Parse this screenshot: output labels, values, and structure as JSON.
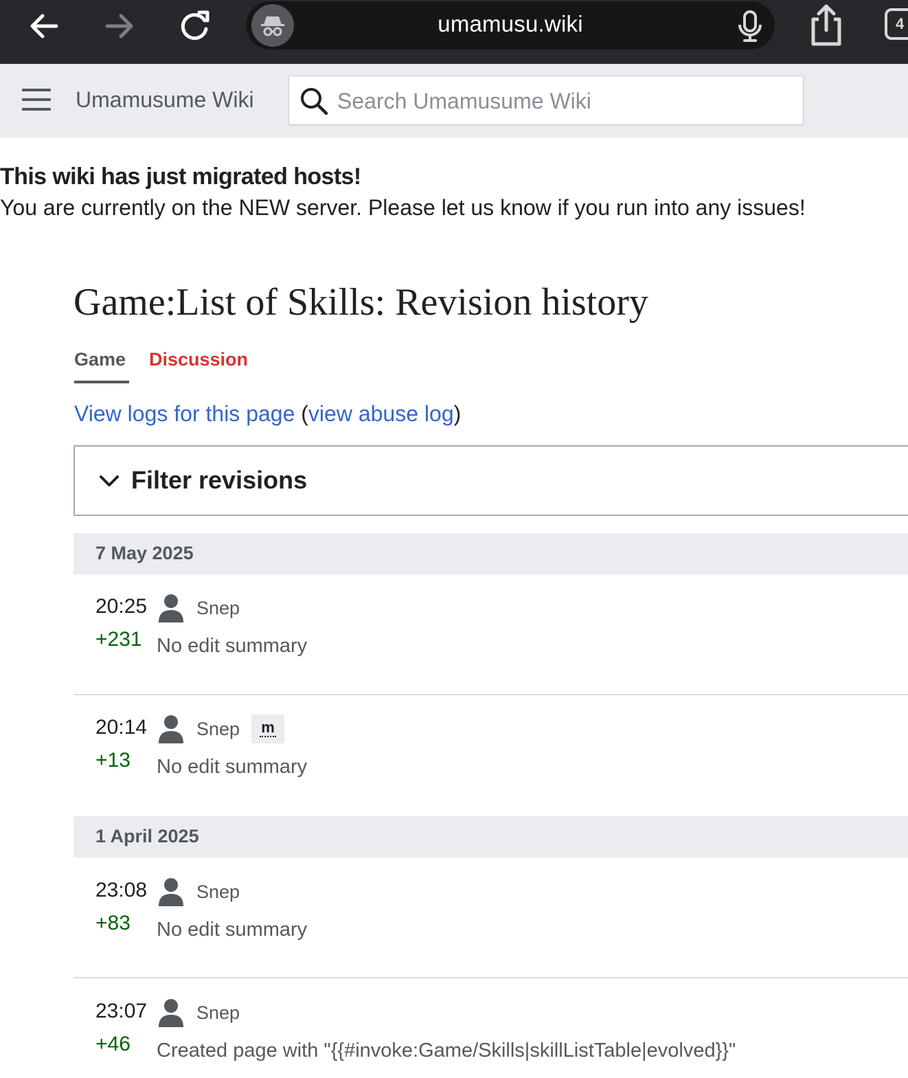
{
  "browser": {
    "url": "umamusu.wiki",
    "tab_count": "4"
  },
  "header": {
    "site_name": "Umamusume Wiki",
    "search_placeholder": "Search Umamusume Wiki"
  },
  "notice": {
    "title": "This wiki has just migrated hosts!",
    "body": "You are currently on the NEW server. Please let us know if you run into any issues!"
  },
  "page": {
    "title": "Game:List of Skills: Revision history",
    "tabs": [
      {
        "label": "Game",
        "active": true
      },
      {
        "label": "Discussion",
        "active": false
      }
    ],
    "logs_link": "View logs for this page",
    "abuse_open": "(",
    "abuse_link": "view abuse log",
    "abuse_close": ")",
    "filter_label": "Filter revisions"
  },
  "revisions": {
    "groups": [
      {
        "date": "7 May 2025",
        "items": [
          {
            "time": "20:25",
            "user": "Snep",
            "diff": "+231",
            "summary": "No edit summary",
            "minor": false
          },
          {
            "time": "20:14",
            "user": "Snep",
            "diff": "+13",
            "summary": "No edit summary",
            "minor": true,
            "minor_label": "m"
          }
        ]
      },
      {
        "date": "1 April 2025",
        "items": [
          {
            "time": "23:08",
            "user": "Snep",
            "diff": "+83",
            "summary": "No edit summary",
            "minor": false
          },
          {
            "time": "23:07",
            "user": "Snep",
            "diff": "+46",
            "summary": "Created page with \"{{#invoke:Game/Skills|skillListTable|evolved}}\"",
            "minor": false
          }
        ]
      }
    ]
  },
  "colors": {
    "link": "#3366cc",
    "red_link": "#d73333",
    "diff_positive": "#006400",
    "chrome_bg": "#27282b"
  }
}
